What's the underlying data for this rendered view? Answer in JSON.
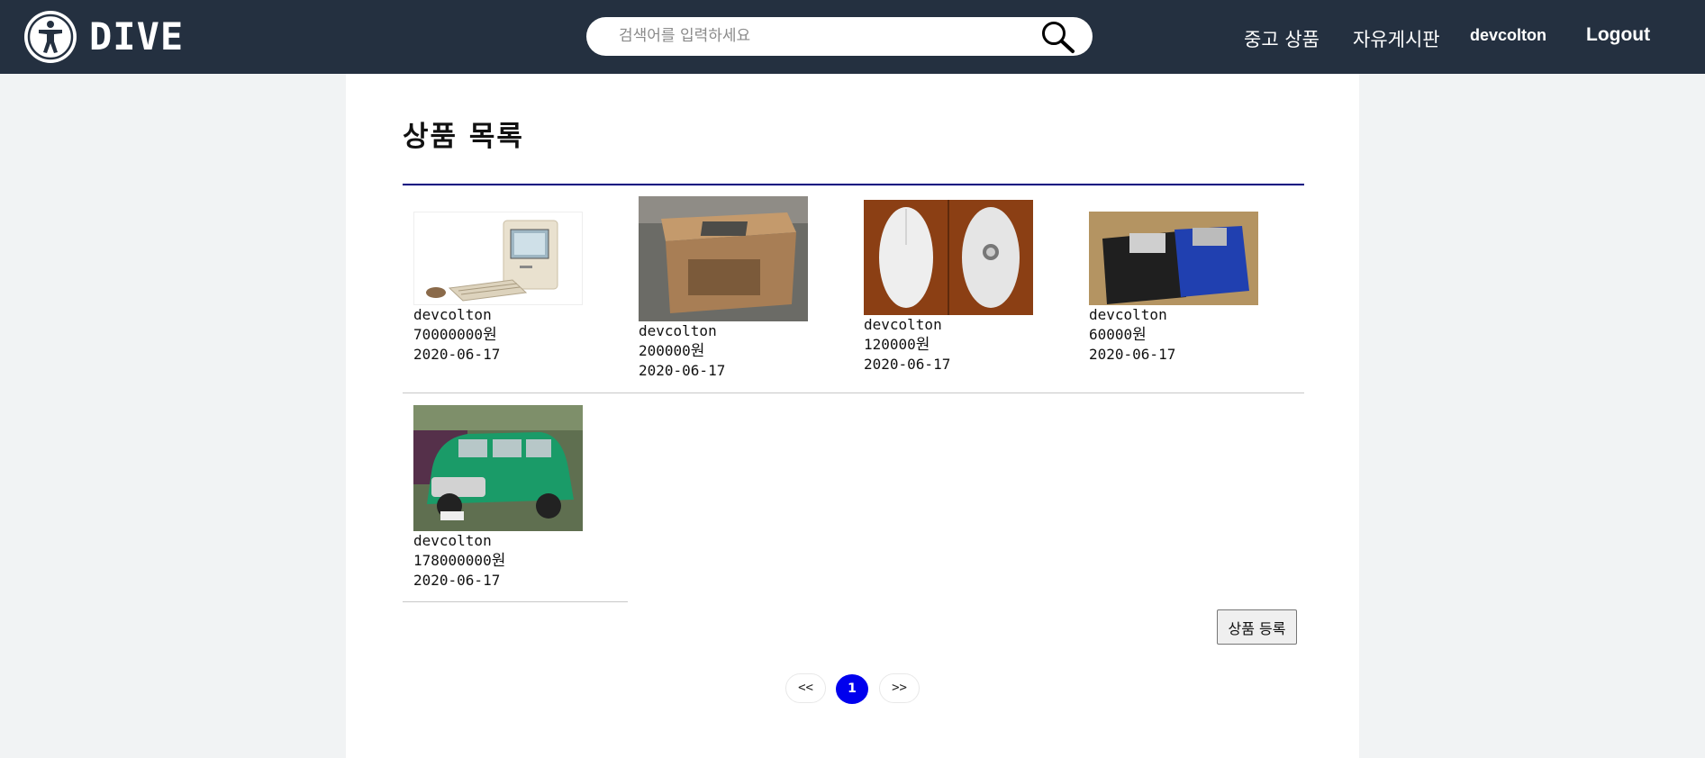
{
  "header": {
    "brand": "DIVE",
    "logo_icon": "accessibility-person-icon",
    "search_placeholder": "검색어를 입력하세요",
    "search_icon": "search-icon",
    "nav": {
      "used_goods": "중고 상품",
      "free_board": "자유게시판",
      "username": "devcolton",
      "logout": "Logout"
    }
  },
  "main": {
    "title": "상품 목록",
    "products": [
      {
        "seller": "devcolton",
        "price": "70000000",
        "currency": "원",
        "date": "2020-06-17",
        "image": "macintosh-computer"
      },
      {
        "seller": "devcolton",
        "price": "200000",
        "currency": "원",
        "date": "2020-06-17",
        "image": "wooden-box-table"
      },
      {
        "seller": "devcolton",
        "price": "120000",
        "currency": "원",
        "date": "2020-06-17",
        "image": "white-mouse"
      },
      {
        "seller": "devcolton",
        "price": "60000",
        "currency": "원",
        "date": "2020-06-17",
        "image": "floppy-disks"
      },
      {
        "seller": "devcolton",
        "price": "178000000",
        "currency": "원",
        "date": "2020-06-17",
        "image": "green-mini-car"
      }
    ],
    "register_button": "상품 등록",
    "pagination": {
      "prev": "<<",
      "current": "1",
      "next": ">>"
    }
  },
  "colors": {
    "navbar": "#243040",
    "title_rule": "#000080",
    "active_page": "#0000ee"
  }
}
